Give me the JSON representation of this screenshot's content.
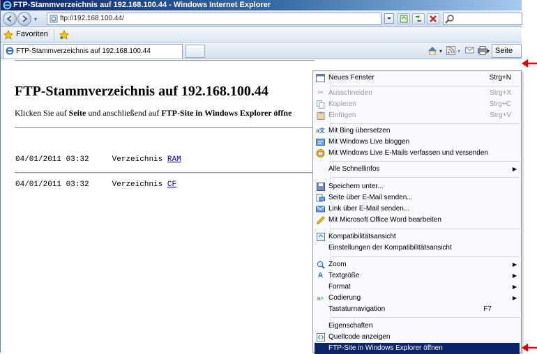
{
  "window": {
    "title": "FTP-Stammverzeichnis auf 192.168.100.44 - Windows Internet Explorer"
  },
  "addressbar": {
    "url": "ftp://192.168.100.44/"
  },
  "favorites": {
    "label": "Favoriten"
  },
  "tab": {
    "label": "FTP-Stammverzeichnis auf 192.168.100.44"
  },
  "commandbar": {
    "seite_label": "Seite ▾"
  },
  "page": {
    "heading": "FTP-Stammverzeichnis auf 192.168.100.44",
    "hint_prefix": "Klicken Sie auf ",
    "hint_bold1": "Seite",
    "hint_mid": " und anschließend auf ",
    "hint_bold2": "FTP-Site in Windows Explorer öffne",
    "listing": [
      {
        "date": "04/01/2011 03:32",
        "type": "Verzeichnis",
        "name": "RAM"
      },
      {
        "date": "04/01/2011 03:32",
        "type": "Verzeichnis",
        "name": "CF"
      }
    ]
  },
  "menu": {
    "items": [
      {
        "label": "Neues Fenster",
        "shortcut": "Strg+N",
        "disabled": false,
        "icon": "window-icon"
      },
      {
        "label": "Ausschneiden",
        "shortcut": "Strg+X",
        "disabled": true,
        "icon": "scissors-icon"
      },
      {
        "label": "Kopieren",
        "shortcut": "Strg+C",
        "disabled": true,
        "icon": "copy-icon"
      },
      {
        "label": "Einfügen",
        "shortcut": "Strg+V",
        "disabled": true,
        "icon": "paste-icon"
      },
      {
        "label": "Mit Bing übersetzen",
        "shortcut": "",
        "disabled": false,
        "icon": "translate-icon"
      },
      {
        "label": "Mit Windows Live bloggen",
        "shortcut": "",
        "disabled": false,
        "icon": "blog-icon"
      },
      {
        "label": "Mit Windows Live E-Mails verfassen und versenden",
        "shortcut": "",
        "disabled": false,
        "icon": "mail-icon"
      },
      {
        "label": "Alle Schnellinfos",
        "shortcut": "",
        "disabled": false,
        "icon": "",
        "submenu": true
      },
      {
        "label": "Speichern unter...",
        "shortcut": "",
        "disabled": false,
        "icon": "save-icon"
      },
      {
        "label": "Seite über E-Mail senden...",
        "shortcut": "",
        "disabled": false,
        "icon": "mail-page-icon"
      },
      {
        "label": "Link über E-Mail senden...",
        "shortcut": "",
        "disabled": false,
        "icon": "mail-link-icon"
      },
      {
        "label": "Mit Microsoft Office Word bearbeiten",
        "shortcut": "",
        "disabled": false,
        "icon": "pencil-icon"
      },
      {
        "label": "Kompatibilitätsansicht",
        "shortcut": "",
        "disabled": false,
        "icon": "compat-icon"
      },
      {
        "label": "Einstellungen der Kompatibilitätsansicht",
        "shortcut": "",
        "disabled": false,
        "icon": ""
      },
      {
        "label": "Zoom",
        "shortcut": "",
        "disabled": false,
        "icon": "zoom-icon",
        "submenu": true
      },
      {
        "label": "Textgröße",
        "shortcut": "",
        "disabled": false,
        "icon": "textsize-icon",
        "submenu": true
      },
      {
        "label": "Format",
        "shortcut": "",
        "disabled": false,
        "icon": "",
        "submenu": true
      },
      {
        "label": "Codierung",
        "shortcut": "",
        "disabled": false,
        "icon": "encoding-icon",
        "submenu": true
      },
      {
        "label": "Tastaturnavigation",
        "shortcut": "F7",
        "disabled": false,
        "icon": ""
      },
      {
        "label": "Eigenschaften",
        "shortcut": "",
        "disabled": false,
        "icon": ""
      },
      {
        "label": "Quellcode anzeigen",
        "shortcut": "",
        "disabled": false,
        "icon": "source-icon"
      },
      {
        "label": "FTP-Site in Windows Explorer öffnen",
        "shortcut": "",
        "disabled": false,
        "icon": "",
        "highlighted": true
      }
    ]
  },
  "colors": {
    "menu_highlight": "#0a246a",
    "annotation_arrow": "#e00000",
    "link": "#0000cc"
  }
}
